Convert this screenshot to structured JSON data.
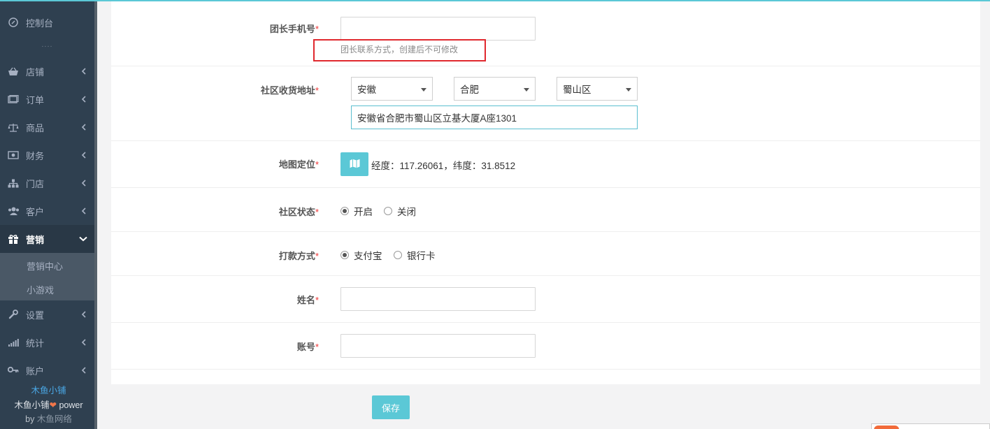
{
  "sidebar": {
    "items": [
      {
        "label": "控制台",
        "icon": "dashboard-icon"
      },
      {
        "label": "店铺",
        "icon": "basket-icon"
      },
      {
        "label": "订单",
        "icon": "order-icon"
      },
      {
        "label": "商品",
        "icon": "scale-icon"
      },
      {
        "label": "财务",
        "icon": "money-icon"
      },
      {
        "label": "门店",
        "icon": "sitemap-icon"
      },
      {
        "label": "客户",
        "icon": "users-icon"
      },
      {
        "label": "营销",
        "icon": "gift-icon"
      },
      {
        "label": "设置",
        "icon": "wrench-icon"
      },
      {
        "label": "统计",
        "icon": "signal-icon"
      },
      {
        "label": "账户",
        "icon": "key-icon"
      }
    ],
    "dots": "....",
    "submenu": [
      "营销中心",
      "小游戏"
    ],
    "brand": {
      "name": "木鱼小铺",
      "power_line": "木鱼小铺",
      "power_word": "power",
      "by_line": "by",
      "company": "木鱼网络"
    }
  },
  "form": {
    "phone": {
      "label": "团长手机号",
      "value": "",
      "help": "团长联系方式，创建后不可修改"
    },
    "address": {
      "label": "社区收货地址",
      "province": "安徽",
      "city": "合肥",
      "district": "蜀山区",
      "detail": "安徽省合肥市蜀山区立基大厦A座1301"
    },
    "map": {
      "label": "地图定位",
      "coords": "经度：117.26061，纬度：31.8512"
    },
    "status": {
      "label": "社区状态",
      "options": [
        "开启",
        "关闭"
      ],
      "selected": "开启"
    },
    "payment": {
      "label": "打款方式",
      "options": [
        "支付宝",
        "银行卡"
      ],
      "selected": "支付宝"
    },
    "name": {
      "label": "姓名",
      "value": ""
    },
    "account": {
      "label": "账号",
      "value": ""
    },
    "required_mark": "*"
  },
  "footer": {
    "save_label": "保存"
  },
  "colors": {
    "accent": "#5bc8d6",
    "sidebar": "#2f4050",
    "required": "#e33333",
    "highlight_box": "#e0282e"
  }
}
